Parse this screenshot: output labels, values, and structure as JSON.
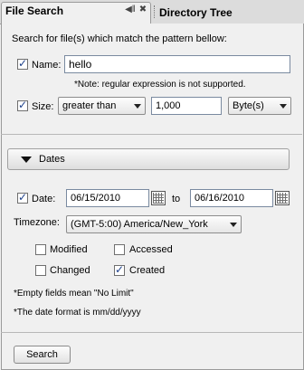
{
  "tabs": {
    "active": "File Search",
    "inactive": "Directory Tree"
  },
  "search": {
    "intro": "Search for file(s) which match the pattern bellow:",
    "name_label": "Name:",
    "name_value": "hello",
    "name_checked": true,
    "note": "*Note: regular expression is not supported.",
    "size_label": "Size:",
    "size_checked": true,
    "size_operator": "greater than",
    "size_value": "1,000",
    "size_unit": "Byte(s)"
  },
  "dates": {
    "section_title": "Dates",
    "date_label": "Date:",
    "date_checked": true,
    "from": "06/15/2010",
    "to_label": "to",
    "to": "06/16/2010",
    "timezone_label": "Timezone:",
    "timezone": "(GMT-5:00) America/New_York",
    "options": [
      {
        "label": "Modified",
        "checked": false
      },
      {
        "label": "Accessed",
        "checked": false
      },
      {
        "label": "Changed",
        "checked": false
      },
      {
        "label": "Created",
        "checked": true
      }
    ],
    "hint_empty": "*Empty fields mean \"No Limit\"",
    "hint_format": "*The date format is mm/dd/yyyy"
  },
  "actions": {
    "search_label": "Search"
  },
  "colors": {
    "check": "#1c3f8a",
    "panel": "#f0f0f0"
  }
}
